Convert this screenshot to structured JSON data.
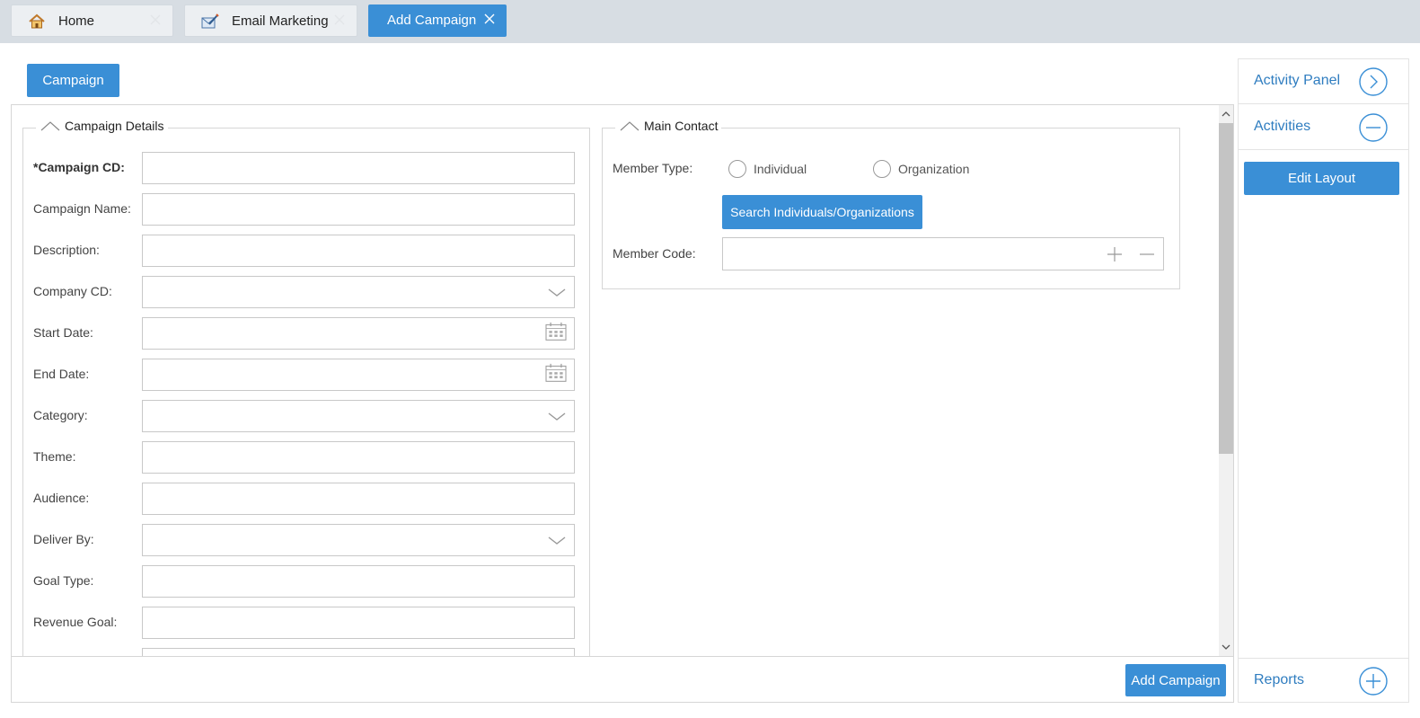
{
  "tabs": [
    {
      "label": "Home",
      "icon": "home-icon",
      "active": false
    },
    {
      "label": "Email Marketing",
      "icon": "email-marketing-icon",
      "active": false
    },
    {
      "label": "Add Campaign",
      "icon": "",
      "active": true
    }
  ],
  "section": {
    "campaign_label": "Campaign"
  },
  "campaign_details": {
    "legend": "Campaign Details",
    "fields": [
      {
        "label": "*Campaign CD:",
        "value": "",
        "type": "text",
        "required": true
      },
      {
        "label": "Campaign Name:",
        "value": "",
        "type": "text"
      },
      {
        "label": "Description:",
        "value": "",
        "type": "text"
      },
      {
        "label": "Company CD:",
        "value": "",
        "type": "select"
      },
      {
        "label": "Start Date:",
        "value": "",
        "type": "date"
      },
      {
        "label": "End Date:",
        "value": "",
        "type": "date"
      },
      {
        "label": "Category:",
        "value": "",
        "type": "select"
      },
      {
        "label": "Theme:",
        "value": "",
        "type": "text"
      },
      {
        "label": "Audience:",
        "value": "",
        "type": "text"
      },
      {
        "label": "Deliver By:",
        "value": "",
        "type": "select"
      },
      {
        "label": "Goal Type:",
        "value": "",
        "type": "text"
      },
      {
        "label": "Revenue Goal:",
        "value": "",
        "type": "text"
      }
    ]
  },
  "main_contact": {
    "legend": "Main Contact",
    "member_type_label": "Member Type:",
    "options": [
      "Individual",
      "Organization"
    ],
    "search_button": "Search Individuals/Organizations",
    "member_code_label": "Member Code:",
    "member_code_value": ""
  },
  "footer": {
    "add_campaign_button": "Add Campaign"
  },
  "right_panel": {
    "activity_panel": "Activity Panel",
    "activities": "Activities",
    "edit_layout": "Edit Layout",
    "reports": "Reports"
  },
  "colors": {
    "accent": "#3a8fd6",
    "link": "#2f7dc0",
    "tabbar": "#d7dde3"
  }
}
